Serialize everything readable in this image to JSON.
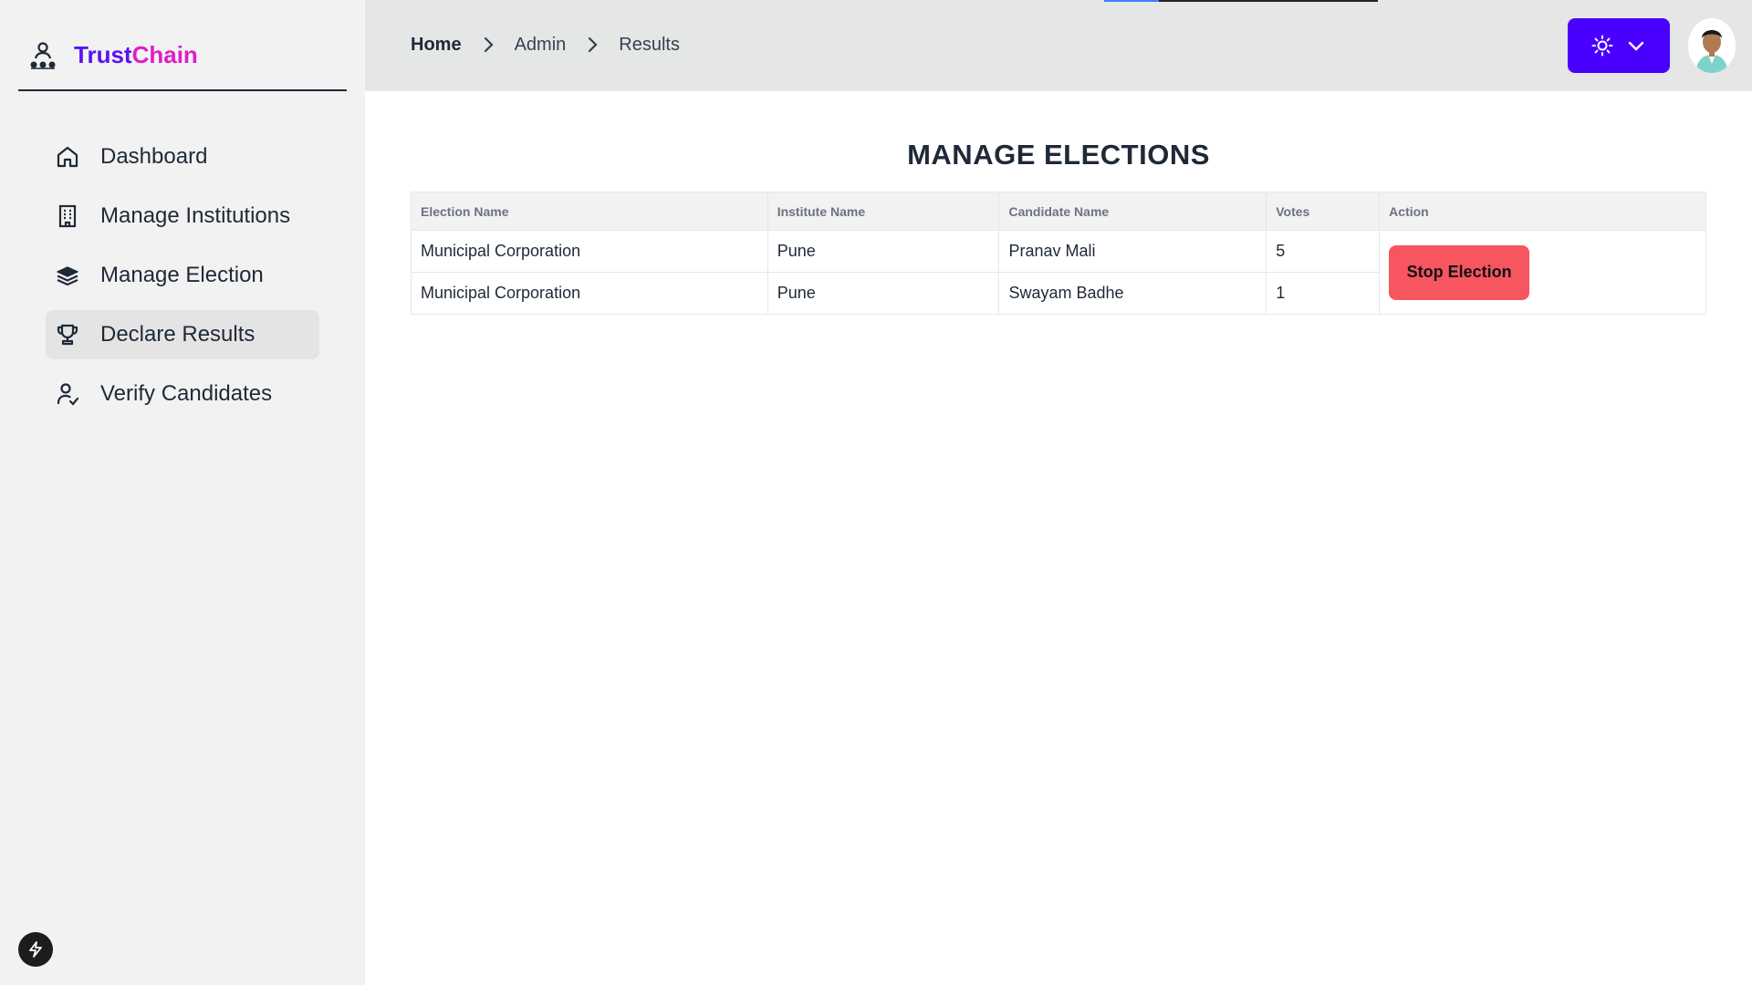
{
  "brand": {
    "name_part1": "Trust",
    "name_part2": "Chain",
    "icon": "org-chart-user-icon"
  },
  "sidebar": {
    "items": [
      {
        "label": "Dashboard",
        "icon": "home-icon",
        "active": false
      },
      {
        "label": "Manage Institutions",
        "icon": "building-icon",
        "active": false
      },
      {
        "label": "Manage Election",
        "icon": "layers-icon",
        "active": false
      },
      {
        "label": "Declare Results",
        "icon": "trophy-icon",
        "active": true
      },
      {
        "label": "Verify Candidates",
        "icon": "user-check-icon",
        "active": false
      }
    ],
    "bottom_icon": "bolt-icon"
  },
  "header": {
    "breadcrumb": [
      "Home",
      "Admin",
      "Results"
    ],
    "theme_button_icons": [
      "sun-icon",
      "chevron-down-icon"
    ],
    "avatar": "user-avatar"
  },
  "main": {
    "title": "MANAGE ELECTIONS",
    "table": {
      "columns": [
        "Election Name",
        "Institute Name",
        "Candidate Name",
        "Votes",
        "Action"
      ],
      "rows": [
        [
          "Municipal Corporation",
          "Pune",
          "Pranav Mali",
          "5"
        ],
        [
          "Municipal Corporation",
          "Pune",
          "Swayam Badhe",
          "1"
        ]
      ],
      "action_label": "Stop Election"
    }
  },
  "colors": {
    "accent": "#4a00ff",
    "brand_purple": "#5b12f3",
    "brand_pink": "#e11dc8",
    "danger": "#f75560"
  }
}
